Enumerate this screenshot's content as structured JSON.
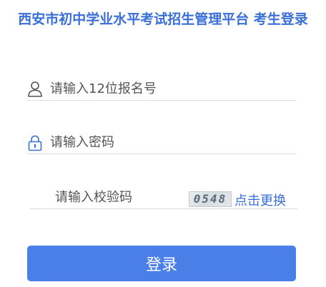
{
  "header": {
    "title": "西安市初中学业水平考试招生管理平台 考生登录"
  },
  "form": {
    "account": {
      "placeholder": "请输入12位报名号",
      "value": "",
      "icon": "user-icon"
    },
    "password": {
      "placeholder": "请输入密码",
      "value": "",
      "icon": "lock-icon"
    },
    "captcha": {
      "placeholder": "请输入校验码",
      "value": "",
      "image_text": "0548",
      "refresh_label": "点击更换"
    },
    "submit_label": "登录"
  },
  "colors": {
    "accent": "#3a6fd8",
    "button": "#4a7fe8",
    "divider": "#d9d9d9"
  }
}
